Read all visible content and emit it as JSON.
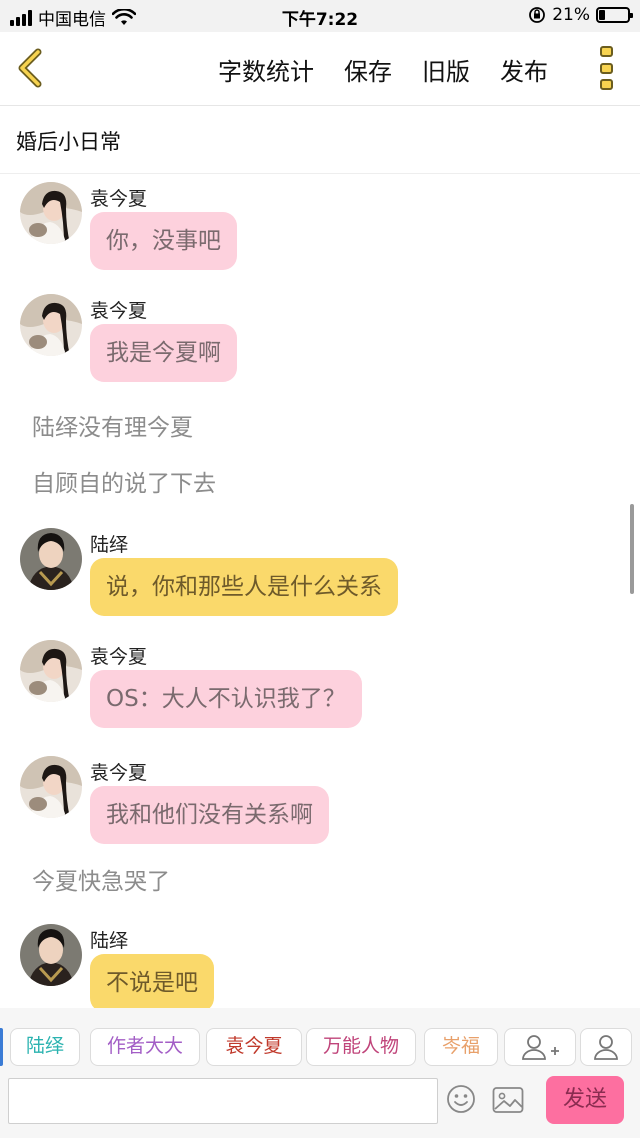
{
  "status_bar": {
    "carrier": "中国电信",
    "time": "下午7:22",
    "battery_percent": "21%",
    "battery_level": 0.21
  },
  "nav": {
    "actions": [
      "字数统计",
      "保存",
      "旧版",
      "发布"
    ]
  },
  "document": {
    "title": "婚后小日常"
  },
  "messages": [
    {
      "kind": "chat",
      "sender": "袁今夏",
      "text": "你，没事吧",
      "color": "pink"
    },
    {
      "kind": "chat",
      "sender": "袁今夏",
      "text": "我是今夏啊",
      "color": "pink"
    },
    {
      "kind": "narration",
      "text": "陆绎没有理今夏"
    },
    {
      "kind": "narration",
      "text": "自顾自的说了下去"
    },
    {
      "kind": "chat",
      "sender": "陆绎",
      "text": "说，你和那些人是什么关系",
      "color": "yellow"
    },
    {
      "kind": "chat",
      "sender": "袁今夏",
      "text": "OS：大人不认识我了？",
      "color": "pink"
    },
    {
      "kind": "chat",
      "sender": "袁今夏",
      "text": "我和他们没有关系啊",
      "color": "pink"
    },
    {
      "kind": "narration",
      "text": "今夏快急哭了"
    },
    {
      "kind": "chat",
      "sender": "陆绎",
      "text": "不说是吧",
      "color": "yellow"
    }
  ],
  "characters": [
    {
      "label": "陆绎",
      "color": "#2bb3b0"
    },
    {
      "label": "作者大大",
      "color": "#a35ec6"
    },
    {
      "label": "袁今夏",
      "color": "#c0392b"
    },
    {
      "label": "万能人物",
      "color": "#c0447a"
    },
    {
      "label": "岑福",
      "color": "#e8a06a"
    }
  ],
  "composer": {
    "placeholder": "",
    "send_label": "发送"
  },
  "colors": {
    "pink_bubble": "#fdd1dd",
    "yellow_bubble": "#fad96b",
    "send_button": "#fd6fa0",
    "accent_icon": "#f7d350"
  }
}
